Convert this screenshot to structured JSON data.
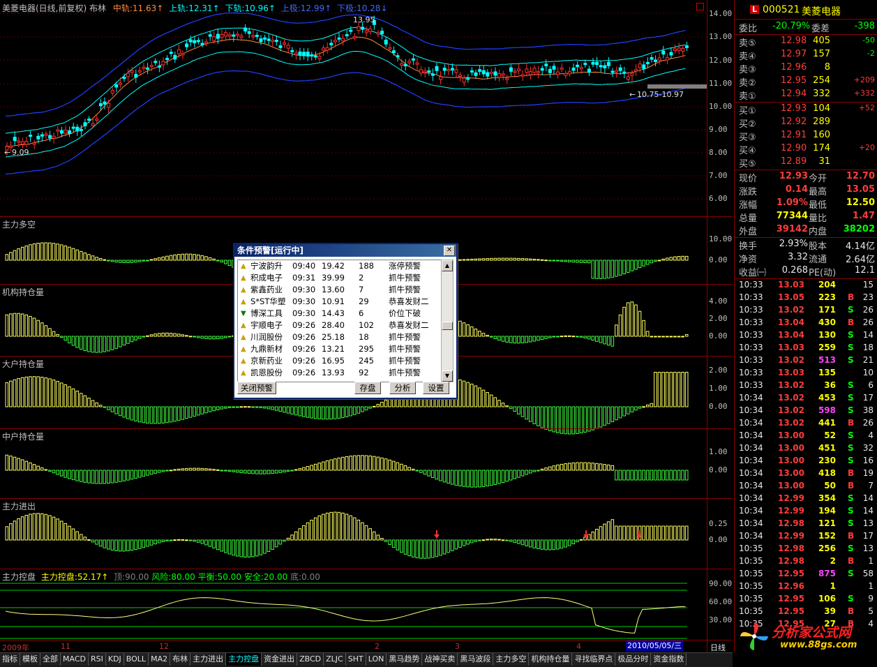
{
  "main_chart": {
    "title": "美菱电器(日线,前复权)",
    "indicator": "布林",
    "mid_label": "中轨:11.63",
    "upper_label": "上轨:12.31",
    "lower_label": "下轨:10.96",
    "up_label": "上极:12.99",
    "down_label": "下极:10.28",
    "high_annotation": "13.95",
    "low_annotation": "9.09",
    "range_annotation": "10.75-10.97",
    "y_ticks": [
      "14.00",
      "13.00",
      "12.00",
      "11.00",
      "10.00",
      "9.00",
      "8.00",
      "7.00",
      "6.00"
    ]
  },
  "panels": [
    {
      "title": "主力多空",
      "ticks": [
        "10.00",
        "0.00"
      ]
    },
    {
      "title": "机构持仓量",
      "ticks": [
        "4.00",
        "2.00",
        "0.00"
      ]
    },
    {
      "title": "大户持仓量",
      "ticks": [
        "2.00",
        "1.00",
        "0.00"
      ]
    },
    {
      "title": "中户持仓量",
      "ticks": [
        "1.00",
        "0.00"
      ]
    },
    {
      "title": "主力进出",
      "ticks": [
        "0.25",
        "0.00"
      ]
    }
  ],
  "control_panel": {
    "title": "主力控盘",
    "value_label": "主力控盘:52.17",
    "top_label": "顶:90.00",
    "risk_label": "风险:80.00",
    "balance_label": "平衡:50.00",
    "safe_label": "安全:20.00",
    "bottom_label": "底:0.00",
    "ticks": [
      "90.00",
      "60.00",
      "30.00"
    ]
  },
  "x_axis": [
    "2009年",
    "11",
    "12",
    "2",
    "3",
    "4"
  ],
  "x_cursor": "2010/05/05/三",
  "period_label": "日线",
  "dialog": {
    "title": "条件预警[运行中]",
    "rows": [
      {
        "name": "宁波韵升",
        "time": "09:40",
        "price": "19.42",
        "vol": "188",
        "signal": "涨停预警"
      },
      {
        "name": "积成电子",
        "time": "09:31",
        "price": "39.99",
        "vol": "2",
        "signal": "抓牛预警"
      },
      {
        "name": "紫鑫药业",
        "time": "09:30",
        "price": "13.60",
        "vol": "7",
        "signal": "抓牛预警"
      },
      {
        "name": "S*ST华塑",
        "time": "09:30",
        "price": "10.91",
        "vol": "29",
        "signal": "恭喜发财二"
      },
      {
        "name": "博深工具",
        "time": "09:30",
        "price": "14.43",
        "vol": "6",
        "signal": "价位下破"
      },
      {
        "name": "宇顺电子",
        "time": "09:26",
        "price": "28.40",
        "vol": "102",
        "signal": "恭喜发财二"
      },
      {
        "name": "川润股份",
        "time": "09:26",
        "price": "25.18",
        "vol": "18",
        "signal": "抓牛预警"
      },
      {
        "name": "九鼎新材",
        "time": "09:26",
        "price": "13.21",
        "vol": "295",
        "signal": "抓牛预警"
      },
      {
        "name": "京新药业",
        "time": "09:26",
        "price": "16.95",
        "vol": "245",
        "signal": "抓牛预警"
      },
      {
        "name": "凯恩股份",
        "time": "09:26",
        "price": "13.93",
        "vol": "92",
        "signal": "抓牛预警"
      }
    ],
    "btn_close": "关闭预警",
    "btn_save": "存盘",
    "btn_analyze": "分析",
    "btn_settings": "设置"
  },
  "quote": {
    "code": "000521",
    "name": "美菱电器",
    "weibi_label": "委比",
    "weibi": "-20.79%",
    "weicha_label": "委差",
    "weicha": "-398",
    "asks": [
      {
        "label": "卖⑤",
        "price": "12.98",
        "vol": "405",
        "chg": "-50"
      },
      {
        "label": "卖④",
        "price": "12.97",
        "vol": "157",
        "chg": "-2"
      },
      {
        "label": "卖③",
        "price": "12.96",
        "vol": "8",
        "chg": ""
      },
      {
        "label": "卖②",
        "price": "12.95",
        "vol": "254",
        "chg": "+209"
      },
      {
        "label": "卖①",
        "price": "12.94",
        "vol": "332",
        "chg": "+332"
      }
    ],
    "bids": [
      {
        "label": "买①",
        "price": "12.93",
        "vol": "104",
        "chg": "+52"
      },
      {
        "label": "买②",
        "price": "12.92",
        "vol": "289",
        "chg": ""
      },
      {
        "label": "买③",
        "price": "12.91",
        "vol": "160",
        "chg": ""
      },
      {
        "label": "买④",
        "price": "12.90",
        "vol": "174",
        "chg": "+20"
      },
      {
        "label": "买⑤",
        "price": "12.89",
        "vol": "31",
        "chg": ""
      }
    ],
    "stats": [
      {
        "l1": "现价",
        "v1": "12.93",
        "l2": "今开",
        "v2": "12.70"
      },
      {
        "l1": "涨跌",
        "v1": "0.14",
        "l2": "最高",
        "v2": "13.05"
      },
      {
        "l1": "涨幅",
        "v1": "1.09%",
        "l2": "最低",
        "v2": "12.50"
      },
      {
        "l1": "总量",
        "v1": "77344",
        "l2": "量比",
        "v2": "1.47"
      },
      {
        "l1": "外盘",
        "v1": "39142",
        "l2": "内盘",
        "v2": "38202"
      }
    ],
    "stats2": [
      {
        "l1": "换手",
        "v1": "2.93%",
        "l2": "股本",
        "v2": "4.14亿"
      },
      {
        "l1": "净资",
        "v1": "3.32",
        "l2": "流通",
        "v2": "2.64亿"
      },
      {
        "l1": "收益㈠",
        "v1": "0.268",
        "l2": "PE(动)",
        "v2": "12.1"
      }
    ],
    "ticks": [
      {
        "t": "10:33",
        "p": "13.03",
        "v": "204",
        "s": "",
        "n": "15"
      },
      {
        "t": "10:33",
        "p": "13.05",
        "v": "223",
        "s": "B",
        "n": "23"
      },
      {
        "t": "10:33",
        "p": "13.02",
        "v": "171",
        "s": "S",
        "n": "26"
      },
      {
        "t": "10:33",
        "p": "13.04",
        "v": "430",
        "s": "B",
        "n": "26"
      },
      {
        "t": "10:33",
        "p": "13.04",
        "v": "130",
        "s": "S",
        "n": "14"
      },
      {
        "t": "10:33",
        "p": "13.03",
        "v": "259",
        "s": "S",
        "n": "18"
      },
      {
        "t": "10:33",
        "p": "13.02",
        "v": "513",
        "s": "S",
        "n": "21"
      },
      {
        "t": "10:33",
        "p": "13.03",
        "v": "135",
        "s": "",
        "n": "10"
      },
      {
        "t": "10:33",
        "p": "13.02",
        "v": "36",
        "s": "S",
        "n": "6"
      },
      {
        "t": "10:34",
        "p": "13.02",
        "v": "453",
        "s": "S",
        "n": "17"
      },
      {
        "t": "10:34",
        "p": "13.02",
        "v": "598",
        "s": "S",
        "n": "38"
      },
      {
        "t": "10:34",
        "p": "13.02",
        "v": "441",
        "s": "B",
        "n": "26"
      },
      {
        "t": "10:34",
        "p": "13.00",
        "v": "52",
        "s": "S",
        "n": "4"
      },
      {
        "t": "10:34",
        "p": "13.00",
        "v": "451",
        "s": "S",
        "n": "32"
      },
      {
        "t": "10:34",
        "p": "13.00",
        "v": "230",
        "s": "S",
        "n": "16"
      },
      {
        "t": "10:34",
        "p": "13.00",
        "v": "418",
        "s": "B",
        "n": "19"
      },
      {
        "t": "10:34",
        "p": "13.00",
        "v": "50",
        "s": "B",
        "n": "7"
      },
      {
        "t": "10:34",
        "p": "12.99",
        "v": "354",
        "s": "S",
        "n": "14"
      },
      {
        "t": "10:34",
        "p": "12.99",
        "v": "194",
        "s": "S",
        "n": "14"
      },
      {
        "t": "10:34",
        "p": "12.98",
        "v": "121",
        "s": "S",
        "n": "13"
      },
      {
        "t": "10:34",
        "p": "12.99",
        "v": "152",
        "s": "B",
        "n": "17"
      },
      {
        "t": "10:35",
        "p": "12.98",
        "v": "256",
        "s": "S",
        "n": "13"
      },
      {
        "t": "10:35",
        "p": "12.98",
        "v": "2",
        "s": "B",
        "n": "1"
      },
      {
        "t": "10:35",
        "p": "12.95",
        "v": "875",
        "s": "S",
        "n": "58"
      },
      {
        "t": "10:35",
        "p": "12.96",
        "v": "1",
        "s": "",
        "n": "1"
      },
      {
        "t": "10:35",
        "p": "12.95",
        "v": "106",
        "s": "S",
        "n": "9"
      },
      {
        "t": "10:35",
        "p": "12.95",
        "v": "39",
        "s": "B",
        "n": "5"
      },
      {
        "t": "10:35",
        "p": "12.95",
        "v": "27",
        "s": "B",
        "n": "4"
      }
    ]
  },
  "logo": {
    "name": "分析家公式网",
    "url": "www.88gs.com"
  },
  "tabs": [
    "指标",
    "模板",
    "全部",
    "MACD",
    "RSI",
    "KDJ",
    "BOLL",
    "MA2",
    "布林",
    "主力进出",
    "主力控盘",
    "资金进出",
    "ZBCD",
    "ZLJC",
    "SHT",
    "LON",
    "黑马趋势",
    "战神买卖",
    "黑马波段",
    "主力多空",
    "机构持仓量",
    "寻找临界点",
    "极品分时",
    "资金指数"
  ],
  "active_tab": "主力控盘"
}
